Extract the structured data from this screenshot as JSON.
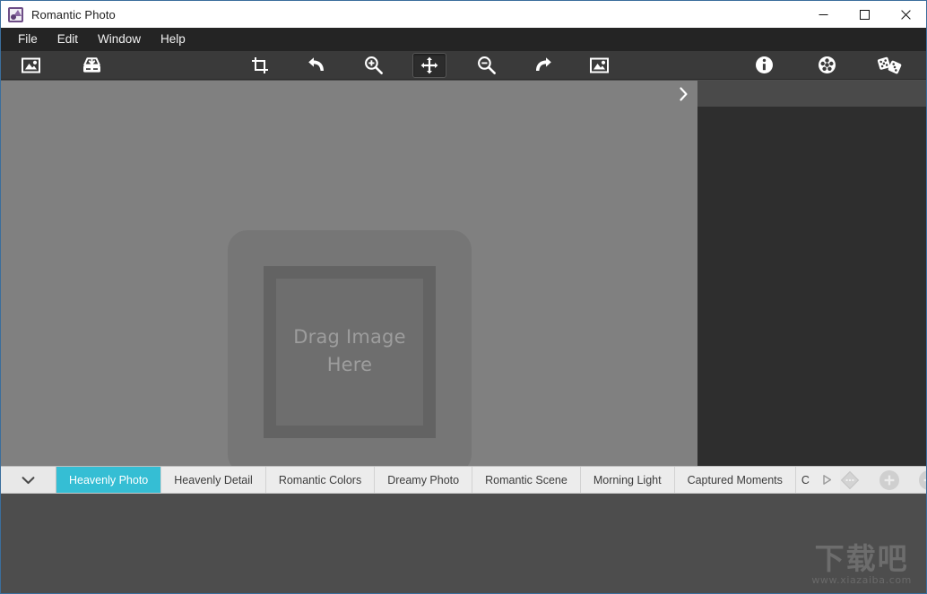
{
  "window": {
    "title": "Romantic Photo",
    "app_icon": "photo-app-icon",
    "controls": {
      "minimize": "minimize-button",
      "maximize": "maximize-button",
      "close": "close-button"
    }
  },
  "menubar": {
    "items": [
      {
        "label": "File"
      },
      {
        "label": "Edit"
      },
      {
        "label": "Window"
      },
      {
        "label": "Help"
      }
    ]
  },
  "toolbar": {
    "left_group": [
      {
        "icon": "open-image-icon",
        "title": "Open Image"
      },
      {
        "icon": "save-image-icon",
        "title": "Save Image"
      }
    ],
    "center_group": [
      {
        "icon": "crop-icon",
        "title": "Crop",
        "active": false
      },
      {
        "icon": "undo-icon",
        "title": "Undo",
        "active": false
      },
      {
        "icon": "zoom-in-icon",
        "title": "Zoom In",
        "active": false
      },
      {
        "icon": "pan-move-icon",
        "title": "Pan",
        "active": true
      },
      {
        "icon": "zoom-out-icon",
        "title": "Zoom Out",
        "active": false
      },
      {
        "icon": "redo-icon",
        "title": "Redo",
        "active": false
      },
      {
        "icon": "fit-image-icon",
        "title": "Fit Image",
        "active": false
      }
    ],
    "right_group": [
      {
        "icon": "info-icon",
        "title": "Info"
      },
      {
        "icon": "effects-icon",
        "title": "Effects"
      },
      {
        "icon": "dice-icon",
        "title": "Randomize"
      }
    ]
  },
  "canvas": {
    "drop_zone": {
      "text_line1": "Drag Image",
      "text_line2": "Here"
    },
    "panel_toggle_icon": "chevron-right-icon"
  },
  "tabbar": {
    "dropdown_icon": "chevron-down-icon",
    "scroll_right_icon": "triangle-right-icon",
    "tabs": [
      {
        "label": "Heavenly Photo",
        "active": true
      },
      {
        "label": "Heavenly Detail",
        "active": false
      },
      {
        "label": "Romantic Colors",
        "active": false
      },
      {
        "label": "Dreamy Photo",
        "active": false
      },
      {
        "label": "Romantic Scene",
        "active": false
      },
      {
        "label": "Morning Light",
        "active": false
      },
      {
        "label": "Captured Moments",
        "active": false
      },
      {
        "label": "C",
        "active": false
      }
    ],
    "actions": [
      {
        "icon": "options-diamond-icon",
        "label": "",
        "enabled": false
      },
      {
        "icon": "plus-icon",
        "label": "",
        "enabled": false
      },
      {
        "icon": "minus-icon",
        "label": "",
        "enabled": false
      }
    ]
  },
  "watermark": {
    "main": "下载吧",
    "sub": "www.xiazaiba.com"
  },
  "colors": {
    "accent": "#35bed4",
    "titlebar": "#ffffff",
    "menubar": "#242424",
    "toolbar": "#3a3a3a",
    "canvas": "#808080",
    "right_panel": "#2e2e2e",
    "tabbar": "#e8e8e8",
    "bottom_strip": "#4d4d4d",
    "window_border": "#3b6e9c"
  }
}
